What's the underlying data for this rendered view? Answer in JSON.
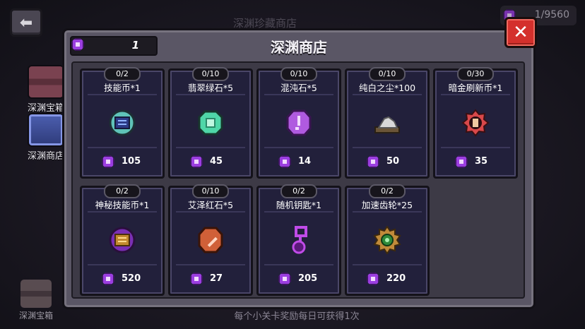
{
  "background": {
    "top_title": "深渊珍藏商店",
    "top_currency": "1/9560",
    "side_tabs": [
      {
        "label": "深渊宝箱",
        "icon": "chest-icon"
      },
      {
        "label": "深渊商店",
        "icon": "shop-icon"
      }
    ],
    "bottom_tab": "深渊宝箱",
    "bottom_hint": "每个小关卡奖励每日可获得1次"
  },
  "dialog": {
    "title": "深渊商店",
    "balance": "1",
    "close_icon": "close-icon"
  },
  "items": [
    {
      "limit": "0/2",
      "name": "技能币*1",
      "price": "105",
      "icon": "skill-coin-icon",
      "color": "#5fc3b8"
    },
    {
      "limit": "0/10",
      "name": "翡翠绿石*5",
      "price": "45",
      "icon": "emerald-stone-icon",
      "color": "#4fd6a8"
    },
    {
      "limit": "0/10",
      "name": "混沌石*5",
      "price": "14",
      "icon": "chaos-stone-icon",
      "color": "#b05ae0"
    },
    {
      "limit": "0/10",
      "name": "纯白之尘*100",
      "price": "50",
      "icon": "white-dust-icon",
      "color": "#d9d9d9"
    },
    {
      "limit": "0/30",
      "name": "暗金刷新币*1",
      "price": "35",
      "icon": "dark-gold-coin-icon",
      "color": "#d8484a"
    },
    {
      "limit": "0/2",
      "name": "神秘技能币*1",
      "price": "520",
      "icon": "mystery-skill-coin-icon",
      "color": "#c28a2e"
    },
    {
      "limit": "0/10",
      "name": "艾泽红石*5",
      "price": "27",
      "icon": "red-stone-icon",
      "color": "#d06038"
    },
    {
      "limit": "0/2",
      "name": "随机钥匙*1",
      "price": "205",
      "icon": "random-key-icon",
      "color": "#a23cd0"
    },
    {
      "limit": "0/2",
      "name": "加速齿轮*25",
      "price": "220",
      "icon": "speed-gear-icon",
      "color": "#c08a3a"
    }
  ]
}
